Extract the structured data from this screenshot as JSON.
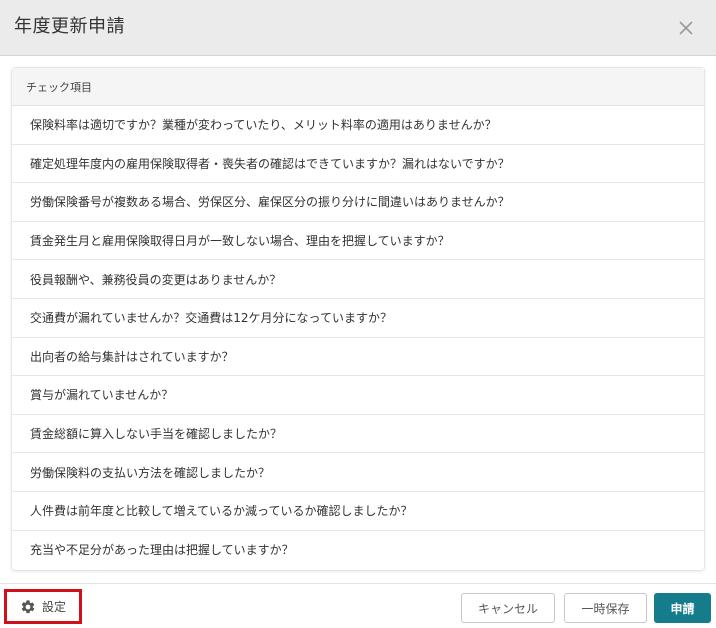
{
  "dialog": {
    "title": "年度更新申請",
    "close_icon": "close-icon"
  },
  "checklist": {
    "header": "チェック項目",
    "items": [
      "保険料率は適切ですか？業種が変わっていたり、メリット料率の適用はありませんか？",
      "確定処理年度内の雇用保険取得者・喪失者の確認はできていますか？漏れはないですか？",
      "労働保険番号が複数ある場合、労保区分、雇保区分の振り分けに間違いはありませんか？",
      "賃金発生月と雇用保険取得日月が一致しない場合、理由を把握していますか？",
      "役員報酬や、兼務役員の変更はありませんか？",
      "交通費が漏れていませんか？交通費は12ケ月分になっていますか？",
      "出向者の給与集計はされていますか？",
      "賞与が漏れていませんか？",
      "賃金総額に算入しない手当を確認しましたか？",
      "労働保険料の支払い方法を確認しましたか？",
      "人件費は前年度と比較して増えているか減っているか確認しましたか？",
      "充当や不足分があった理由は把握していますか？"
    ]
  },
  "footer": {
    "settings_label": "設定",
    "settings_icon": "gear-icon",
    "cancel_label": "キャンセル",
    "save_label": "一時保存",
    "apply_label": "申請"
  },
  "colors": {
    "header_bg": "#ebebeb",
    "primary": "#157c8c",
    "highlight_border": "#d0101a"
  }
}
